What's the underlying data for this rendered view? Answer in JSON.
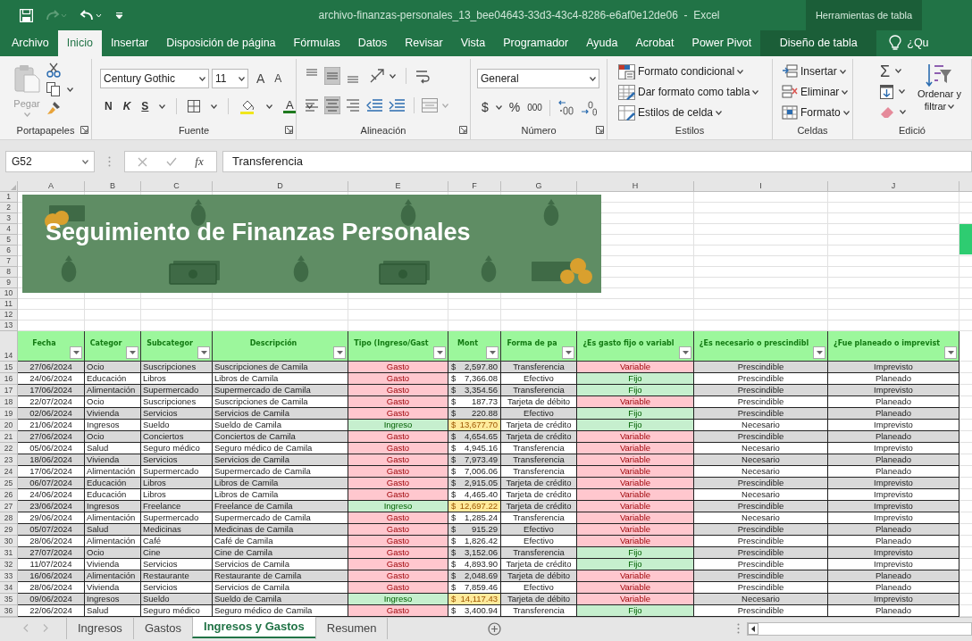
{
  "title_bar": {
    "title": "archivo-finanzas-personales_13_bee04643-33d3-43c4-8286-e6af0e12de06  -  Excel",
    "context_label": "Herramientas de tabla"
  },
  "ribbon_tabs": [
    {
      "label": "Archivo",
      "selected": false
    },
    {
      "label": "Inicio",
      "selected": true
    },
    {
      "label": "Insertar",
      "selected": false
    },
    {
      "label": "Disposición de página",
      "selected": false
    },
    {
      "label": "Fórmulas",
      "selected": false
    },
    {
      "label": "Datos",
      "selected": false
    },
    {
      "label": "Revisar",
      "selected": false
    },
    {
      "label": "Vista",
      "selected": false
    },
    {
      "label": "Programador",
      "selected": false
    },
    {
      "label": "Ayuda",
      "selected": false
    },
    {
      "label": "Acrobat",
      "selected": false
    },
    {
      "label": "Power Pivot",
      "selected": false
    },
    {
      "label": "Diseño de tabla",
      "selected": false,
      "kind": "contextual"
    }
  ],
  "tell_me": "¿Qu",
  "ribbon": {
    "clipboard": {
      "paste": "Pegar",
      "label": "Portapapeles"
    },
    "font": {
      "font_name": "Century Gothic",
      "font_size": "11",
      "grow": "A",
      "shrink": "A",
      "bold": "N",
      "italic": "K",
      "underline": "S",
      "font_color": "A",
      "label": "Fuente"
    },
    "alignment": {
      "label": "Alineación"
    },
    "number": {
      "format": "General",
      "currency": "$",
      "percent": "%",
      "thousands": "000",
      "label": "Número"
    },
    "styles": {
      "commands": [
        "Formato condicional",
        "Dar formato como tabla",
        "Estilos de celda"
      ],
      "label": "Estilos"
    },
    "cells": {
      "commands": [
        "Insertar",
        "Eliminar",
        "Formato"
      ],
      "label": "Celdas"
    },
    "editing": {
      "autosum": "Σ",
      "sort_filter": [
        "Ordenar y",
        "filtrar"
      ],
      "label": "Edició"
    }
  },
  "formula_bar": {
    "name_box": "G52",
    "fx": "fx",
    "formula": "Transferencia"
  },
  "columns": [
    "A",
    "B",
    "C",
    "D",
    "E",
    "F",
    "G",
    "H",
    "I",
    "J"
  ],
  "row_numbers": [
    "1",
    "2",
    "3",
    "4",
    "5",
    "6",
    "7",
    "8",
    "9",
    "10",
    "11",
    "12",
    "13",
    "14",
    "15",
    "16",
    "17",
    "18",
    "19",
    "20",
    "21",
    "22",
    "23",
    "24",
    "25",
    "26",
    "27",
    "28",
    "29",
    "30",
    "31",
    "32",
    "33",
    "34",
    "35",
    "36"
  ],
  "banner": {
    "title": "Seguimiento de Finanzas Personales"
  },
  "table": {
    "headers": [
      "Fecha",
      "Categor",
      "Subcategor",
      "Descripción",
      "Tipo (Ingreso/Gast",
      "Mont",
      "Forma de pa",
      "¿Es gasto fijo o variabl",
      "¿Es necesario o prescindibl",
      "¿Fue planeado o imprevist"
    ],
    "rows": [
      {
        "cells": [
          "27/06/2024",
          "Ocio",
          "Suscripciones",
          "Suscripciones de Camila",
          "Gasto",
          "2,597.80",
          "Transferencia",
          "Variable",
          "Prescindible",
          "Imprevisto"
        ],
        "currency": "$",
        "kind": "expense",
        "fixed": false
      },
      {
        "cells": [
          "24/06/2024",
          "Educación",
          "Libros",
          "Libros de Camila",
          "Gasto",
          "7,366.08",
          "Efectivo",
          "Fijo",
          "Prescindible",
          "Planeado"
        ],
        "currency": "$",
        "kind": "expense",
        "fixed": true
      },
      {
        "cells": [
          "17/06/2024",
          "Alimentación",
          "Supermercado",
          "Supermercado de Camila",
          "Gasto",
          "3,354.56",
          "Transferencia",
          "Fijo",
          "Prescindible",
          "Imprevisto"
        ],
        "currency": "$",
        "kind": "expense",
        "fixed": true
      },
      {
        "cells": [
          "22/07/2024",
          "Ocio",
          "Suscripciones",
          "Suscripciones de Camila",
          "Gasto",
          "187.73",
          "Tarjeta de débito",
          "Variable",
          "Prescindible",
          "Planeado"
        ],
        "currency": "$",
        "kind": "expense",
        "fixed": false
      },
      {
        "cells": [
          "02/06/2024",
          "Vivienda",
          "Servicios",
          "Servicios de Camila",
          "Gasto",
          "220.88",
          "Efectivo",
          "Fijo",
          "Prescindible",
          "Planeado"
        ],
        "currency": "$",
        "kind": "expense",
        "fixed": true
      },
      {
        "cells": [
          "21/06/2024",
          "Ingresos",
          "Sueldo",
          "Sueldo de Camila",
          "Ingreso",
          "13,677.70",
          "Tarjeta de crédito",
          "Fijo",
          "Necesario",
          "Imprevisto"
        ],
        "currency": "$",
        "kind": "income",
        "fixed": true
      },
      {
        "cells": [
          "27/06/2024",
          "Ocio",
          "Conciertos",
          "Conciertos de Camila",
          "Gasto",
          "4,654.65",
          "Tarjeta de crédito",
          "Variable",
          "Prescindible",
          "Planeado"
        ],
        "currency": "$",
        "kind": "expense",
        "fixed": false
      },
      {
        "cells": [
          "05/06/2024",
          "Salud",
          "Seguro médico",
          "Seguro médico de Camila",
          "Gasto",
          "4,945.16",
          "Transferencia",
          "Variable",
          "Necesario",
          "Imprevisto"
        ],
        "currency": "$",
        "kind": "expense",
        "fixed": false
      },
      {
        "cells": [
          "18/06/2024",
          "Vivienda",
          "Servicios",
          "Servicios de Camila",
          "Gasto",
          "7,973.49",
          "Transferencia",
          "Variable",
          "Necesario",
          "Planeado"
        ],
        "currency": "$",
        "kind": "expense",
        "fixed": false
      },
      {
        "cells": [
          "17/06/2024",
          "Alimentación",
          "Supermercado",
          "Supermercado de Camila",
          "Gasto",
          "7,006.06",
          "Transferencia",
          "Variable",
          "Necesario",
          "Planeado"
        ],
        "currency": "$",
        "kind": "expense",
        "fixed": false
      },
      {
        "cells": [
          "06/07/2024",
          "Educación",
          "Libros",
          "Libros de Camila",
          "Gasto",
          "2,915.05",
          "Tarjeta de crédito",
          "Variable",
          "Prescindible",
          "Imprevisto"
        ],
        "currency": "$",
        "kind": "expense",
        "fixed": false
      },
      {
        "cells": [
          "24/06/2024",
          "Educación",
          "Libros",
          "Libros de Camila",
          "Gasto",
          "4,465.40",
          "Tarjeta de crédito",
          "Variable",
          "Necesario",
          "Imprevisto"
        ],
        "currency": "$",
        "kind": "expense",
        "fixed": false
      },
      {
        "cells": [
          "23/06/2024",
          "Ingresos",
          "Freelance",
          "Freelance de Camila",
          "Ingreso",
          "12,697.22",
          "Tarjeta de crédito",
          "Variable",
          "Prescindible",
          "Imprevisto"
        ],
        "currency": "$",
        "kind": "income",
        "fixed": false
      },
      {
        "cells": [
          "29/06/2024",
          "Alimentación",
          "Supermercado",
          "Supermercado de Camila",
          "Gasto",
          "1,285.24",
          "Transferencia",
          "Variable",
          "Necesario",
          "Imprevisto"
        ],
        "currency": "$",
        "kind": "expense",
        "fixed": false
      },
      {
        "cells": [
          "05/07/2024",
          "Salud",
          "Medicinas",
          "Medicinas de Camila",
          "Gasto",
          "915.29",
          "Efectivo",
          "Variable",
          "Prescindible",
          "Planeado"
        ],
        "currency": "$",
        "kind": "expense",
        "fixed": false
      },
      {
        "cells": [
          "28/06/2024",
          "Alimentación",
          "Café",
          "Café de Camila",
          "Gasto",
          "1,826.42",
          "Efectivo",
          "Variable",
          "Prescindible",
          "Planeado"
        ],
        "currency": "$",
        "kind": "expense",
        "fixed": false
      },
      {
        "cells": [
          "27/07/2024",
          "Ocio",
          "Cine",
          "Cine de Camila",
          "Gasto",
          "3,152.06",
          "Transferencia",
          "Fijo",
          "Prescindible",
          "Imprevisto"
        ],
        "currency": "$",
        "kind": "expense",
        "fixed": true
      },
      {
        "cells": [
          "11/07/2024",
          "Vivienda",
          "Servicios",
          "Servicios de Camila",
          "Gasto",
          "4,893.90",
          "Tarjeta de crédito",
          "Fijo",
          "Prescindible",
          "Imprevisto"
        ],
        "currency": "$",
        "kind": "expense",
        "fixed": true
      },
      {
        "cells": [
          "16/06/2024",
          "Alimentación",
          "Restaurante",
          "Restaurante de Camila",
          "Gasto",
          "2,048.69",
          "Tarjeta de débito",
          "Variable",
          "Prescindible",
          "Planeado"
        ],
        "currency": "$",
        "kind": "expense",
        "fixed": false
      },
      {
        "cells": [
          "28/06/2024",
          "Vivienda",
          "Servicios",
          "Servicios de Camila",
          "Gasto",
          "7,859.46",
          "Efectivo",
          "Variable",
          "Prescindible",
          "Planeado"
        ],
        "currency": "$",
        "kind": "expense",
        "fixed": false
      },
      {
        "cells": [
          "09/06/2024",
          "Ingresos",
          "Sueldo",
          "Sueldo de Camila",
          "Ingreso",
          "14,117.43",
          "Tarjeta de débito",
          "Variable",
          "Necesario",
          "Imprevisto"
        ],
        "currency": "$",
        "kind": "income",
        "fixed": false
      },
      {
        "cells": [
          "22/06/2024",
          "Salud",
          "Seguro médico",
          "Seguro médico de Camila",
          "Gasto",
          "3,400.94",
          "Transferencia",
          "Fijo",
          "Prescindible",
          "Planeado"
        ],
        "currency": "$",
        "kind": "expense",
        "fixed": true
      }
    ]
  },
  "sheet_tabs": [
    {
      "label": "Ingresos",
      "selected": false
    },
    {
      "label": "Gastos",
      "selected": false
    },
    {
      "label": "Ingresos y Gastos",
      "selected": true
    },
    {
      "label": "Resumen",
      "selected": false
    }
  ]
}
